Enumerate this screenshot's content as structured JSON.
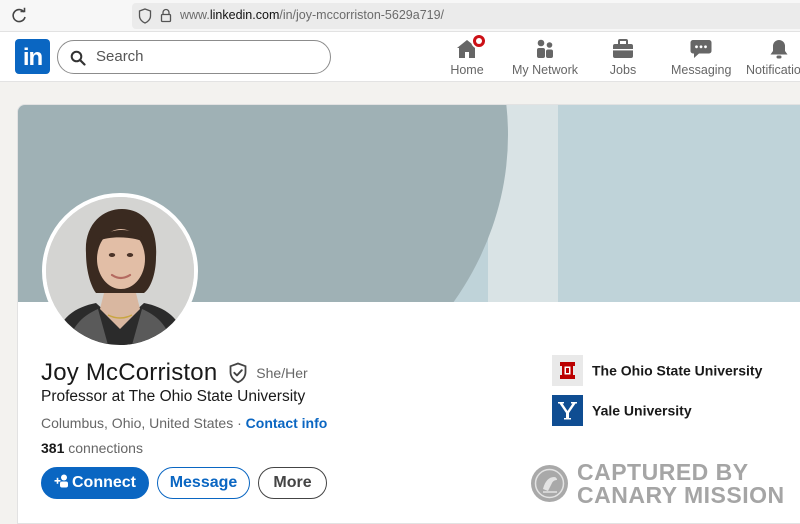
{
  "browser": {
    "url_prefix": "www.",
    "url_domain": "linkedin.com",
    "url_path": "/in/joy-mccorriston-5629a719/"
  },
  "header": {
    "logo_text": "in",
    "search_placeholder": "Search",
    "nav": [
      {
        "label": "Home",
        "icon": "home-icon"
      },
      {
        "label": "My Network",
        "icon": "network-icon"
      },
      {
        "label": "Jobs",
        "icon": "briefcase-icon"
      },
      {
        "label": "Messaging",
        "icon": "messaging-icon"
      },
      {
        "label": "Notifications",
        "icon": "bell-icon"
      }
    ]
  },
  "profile": {
    "name": "Joy McCorriston",
    "pronouns": "She/Her",
    "headline": "Professor at The Ohio State University",
    "location": "Columbus, Ohio, United States",
    "separator": " · ",
    "contact_label": "Contact info",
    "connections_count": "381",
    "connections_label": " connections",
    "buttons": {
      "connect": "Connect",
      "message": "Message",
      "more": "More"
    },
    "education": [
      {
        "name": "The Ohio State University",
        "logo": "osu-logo",
        "color": "#bb0000"
      },
      {
        "name": "Yale University",
        "logo": "yale-logo",
        "color": "#0f4d92"
      }
    ]
  },
  "watermark": {
    "line1": "CAPTURED BY",
    "line2": "CANARY MISSION"
  },
  "colors": {
    "brand": "#0a66c2",
    "notification": "#cc1016",
    "banner": "#bfd3d9"
  }
}
